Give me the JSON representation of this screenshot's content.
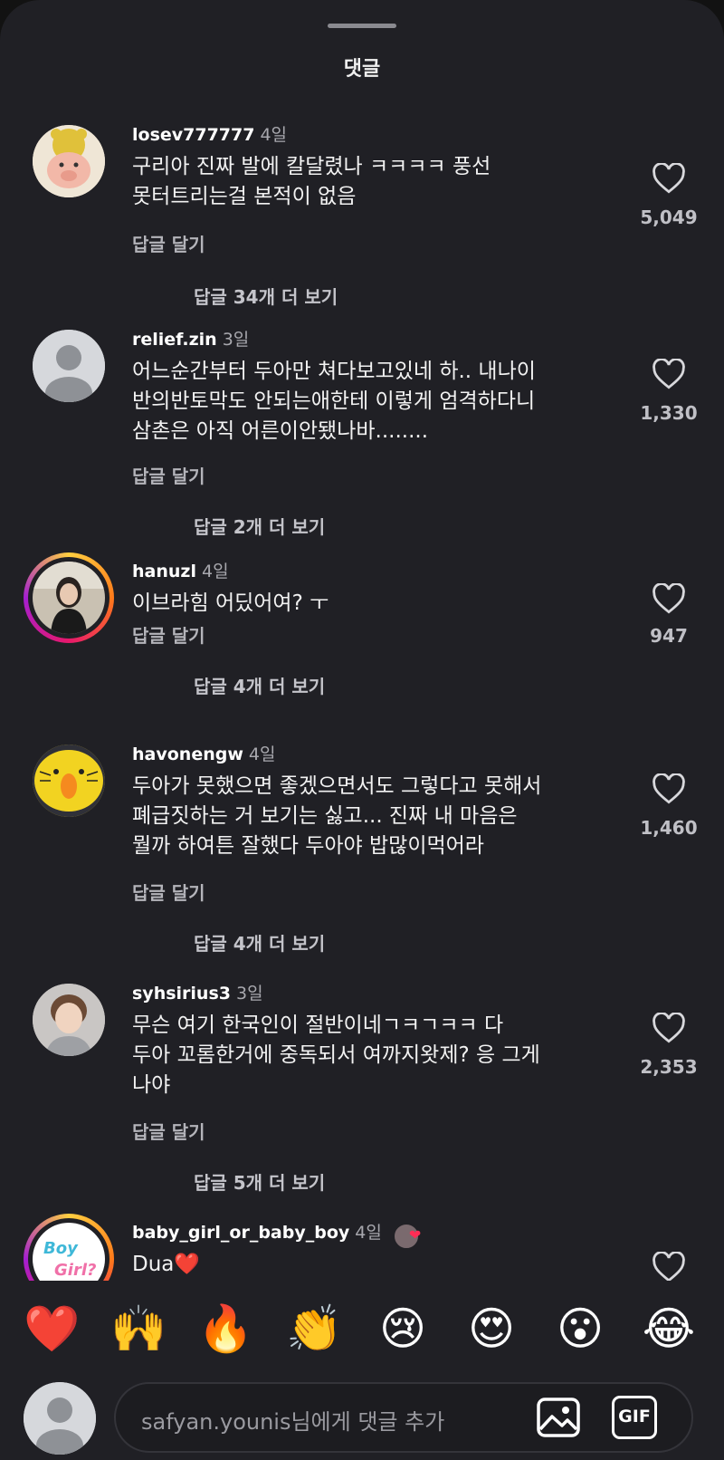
{
  "header": {
    "title": "댓글"
  },
  "comments": [
    {
      "user": "losev777777",
      "time": "4일",
      "lines": [
        "구리아 진짜 발에 칼달렸나 ㅋㅋㅋㅋ 풍선",
        "못터트리는걸 본적이 없음"
      ],
      "likes": "5,049",
      "reply": "답글 달기",
      "more": "답글 34개 더 보기",
      "avatar": "pig-bear-avatar"
    },
    {
      "user": "relief.zin",
      "time": "3일",
      "lines": [
        "어느순간부터 두아만 쳐다보고있네 하.. 내나이",
        "반의반토막도 안되는애한테 이렇게 엄격하다니",
        "삼촌은 아직 어른이안됐나바........"
      ],
      "likes": "1,330",
      "reply": "답글 달기",
      "more": "답글 2개 더 보기",
      "avatar": "default-avatar"
    },
    {
      "user": "hanuzl",
      "time": "4일",
      "lines": [
        "이브라힘 어딨어여? ㅜ"
      ],
      "likes": "947",
      "reply": "답글 달기",
      "more": "답글 4개 더 보기",
      "avatar": "photo-avatar"
    },
    {
      "user": "havonengw",
      "time": "4일",
      "lines": [
        "두아가 못했으면 좋겠으면서도 그렇다고 못해서",
        "폐급짓하는 거 보기는 싫고... 진짜 내 마음은",
        "뭘까 하여튼 잘했다 두아야 밥많이먹어라"
      ],
      "likes": "1,460",
      "reply": "답글 달기",
      "more": "답글 4개 더 보기",
      "avatar": "yellow-cat-avatar"
    },
    {
      "user": "syhsirius3",
      "time": "3일",
      "lines": [
        "무슨 여기 한국인이 절반이네ㄱㅋㄱㅋㅋ  다",
        "두아 꼬롬한거에 중독되서 여까지왓제?  응 그게",
        "나야"
      ],
      "likes": "2,353",
      "reply": "답글 달기",
      "more": "답글 5개 더 보기",
      "avatar": "boy-avatar"
    },
    {
      "user": "baby_girl_or_baby_boy",
      "time": "4일",
      "lines": [
        "Dua❤️"
      ],
      "likes": "",
      "reply": "",
      "more": "",
      "avatar": "boy-or-girl-avatar"
    }
  ],
  "emojis": [
    "❤️",
    "🙌",
    "🔥",
    "👏",
    "😢",
    "😍",
    "😮",
    "😂"
  ],
  "composer": {
    "placeholder": "safyan.younis님에게 댓글 추가",
    "gif_label": "GIF"
  }
}
